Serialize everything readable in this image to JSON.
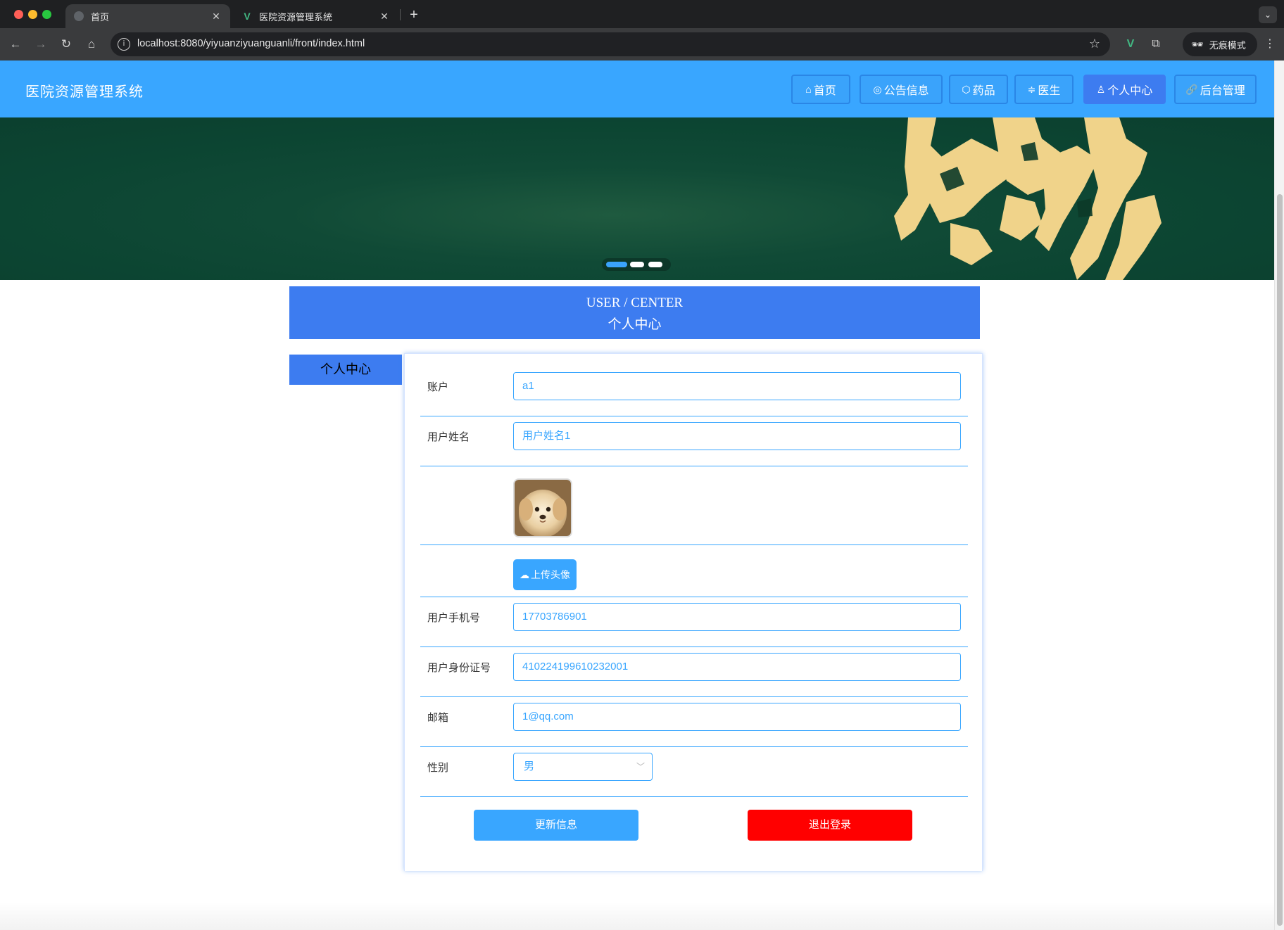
{
  "browser": {
    "tabs": [
      {
        "title": "首页",
        "active": true
      },
      {
        "title": "医院资源管理系统",
        "active": false
      }
    ],
    "url": "localhost:8080/yiyuanziyuanguanli/front/index.html",
    "incognito_label": "无痕模式"
  },
  "site": {
    "title": "医院资源管理系统",
    "menu": [
      {
        "label": "首页",
        "icon": "home-icon",
        "active": false
      },
      {
        "label": "公告信息",
        "icon": "globe-icon",
        "active": false
      },
      {
        "label": "药品",
        "icon": "cube-icon",
        "active": false
      },
      {
        "label": "医生",
        "icon": "sliders-icon",
        "active": false
      },
      {
        "label": "个人中心",
        "icon": "user-icon",
        "active": true
      },
      {
        "label": "后台管理",
        "icon": "link-icon",
        "active": false
      }
    ]
  },
  "banner": {
    "active_slide": 1,
    "slide_count": 3
  },
  "section": {
    "title_en": "USER / CENTER",
    "title_cn": "个人中心"
  },
  "side_nav": {
    "item": "个人中心"
  },
  "form": {
    "account": {
      "label": "账户",
      "value": "a1"
    },
    "user_name": {
      "label": "用户姓名",
      "value": "用户姓名1"
    },
    "avatar": {
      "alt": "puppy avatar"
    },
    "upload_label": "上传头像",
    "phone": {
      "label": "用户手机号",
      "value": "17703786901"
    },
    "id_card": {
      "label": "用户身份证号",
      "value": "410224199610232001"
    },
    "email": {
      "label": "邮箱",
      "value": "1@qq.com"
    },
    "gender": {
      "label": "性别",
      "value": "男"
    },
    "update_button": "更新信息",
    "logout_button": "退出登录"
  },
  "colors": {
    "primary": "#39a6ff",
    "accent": "#3d7cf0",
    "danger": "#ff0000"
  }
}
